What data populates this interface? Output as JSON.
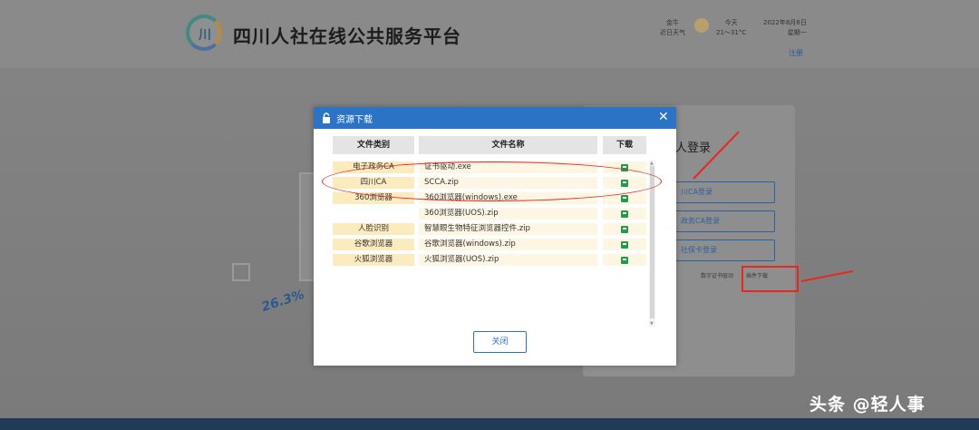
{
  "header": {
    "site_title": "四川人社在线公共服务平台",
    "weather_today_label": "今天",
    "weather_temp": "21～31°C",
    "weather_city_label": "金牛",
    "weather_city_desc": "近日天气",
    "date": "2022年8月8日",
    "weekday": "星期一",
    "register": "注册"
  },
  "login": {
    "title": "人登录",
    "buttons": [
      "川CA登录",
      "政务CA登录",
      "社保卡登录"
    ],
    "plugin_hint": "数字证书驱动",
    "plugin_link": "插件下载"
  },
  "decor": {
    "percent": "26.3%"
  },
  "modal": {
    "title": "资源下载",
    "columns": [
      "文件类别",
      "文件名称",
      "下载"
    ],
    "rows": [
      {
        "category": "电子政务CA",
        "file": "证书驱动.exe"
      },
      {
        "category": "四川CA",
        "file": "SCCA.zip"
      },
      {
        "category": "360浏览器",
        "file": "360浏览器(windows).exe"
      },
      {
        "category": "",
        "file": "360浏览器(UOS).zip"
      },
      {
        "category": "人脸识别",
        "file": "智慧眼生物特征浏览器控件.zip"
      },
      {
        "category": "谷歌浏览器",
        "file": "谷歌浏览器(windows).zip"
      },
      {
        "category": "火狐浏览器",
        "file": "火狐浏览器(UOS).zip"
      }
    ],
    "close_button": "关闭"
  },
  "watermark": "头条 @轻人事",
  "colors": {
    "primary": "#2b73c5",
    "annotation": "#e8281e",
    "download_icon": "#1e9e4a"
  }
}
